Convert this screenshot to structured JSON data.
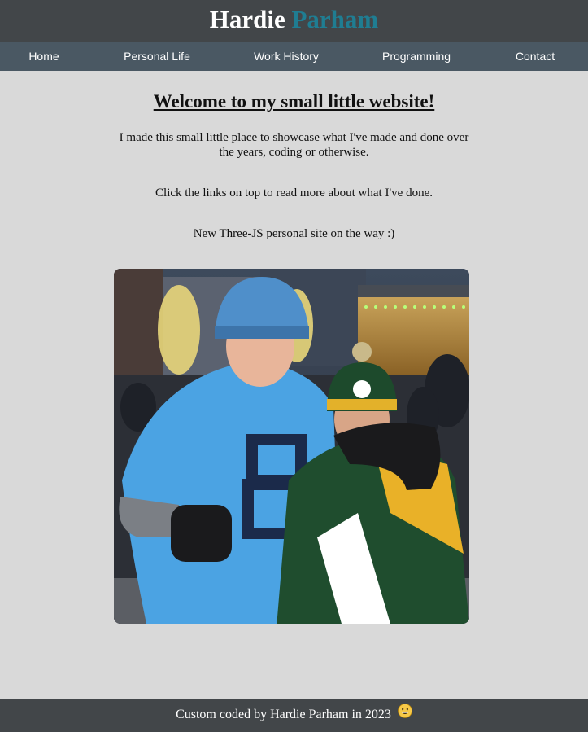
{
  "header": {
    "first_name": "Hardie",
    "last_name": "Parham"
  },
  "nav": {
    "items": [
      {
        "label": "Home"
      },
      {
        "label": "Personal Life"
      },
      {
        "label": "Work History"
      },
      {
        "label": "Programming"
      },
      {
        "label": "Contact"
      }
    ]
  },
  "main": {
    "welcome": "Welcome to my small little website!",
    "intro": "I made this small little place to showcase what I've made and done over the years, coding or otherwise.",
    "links_note": "Click the links on top to read more about what I've done.",
    "announcement": "New Three-JS personal site on the way :)"
  },
  "footer": {
    "credit": "Custom coded by Hardie Parham in 2023"
  },
  "colors": {
    "header_bg": "#424649",
    "nav_bg": "#4a5863",
    "accent": "#1f7d92",
    "page_bg": "#d9d9d9"
  }
}
